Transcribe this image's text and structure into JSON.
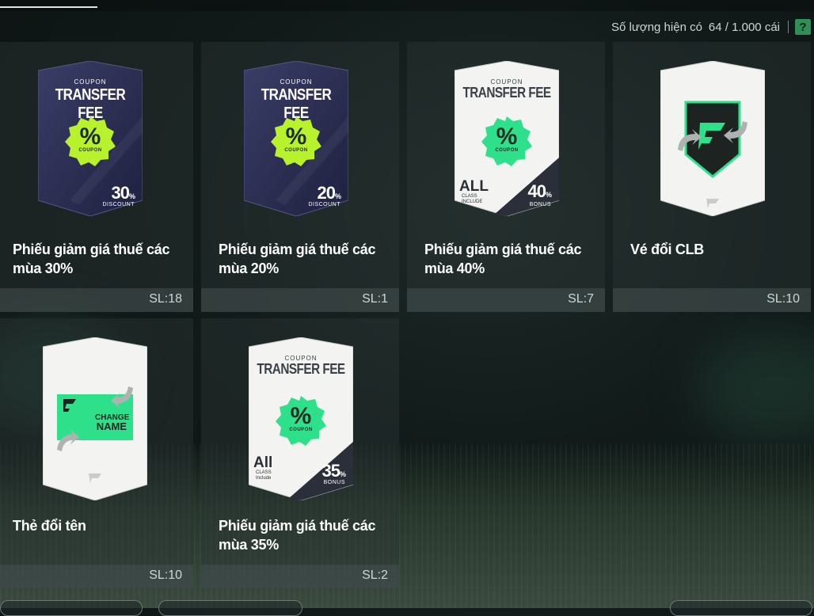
{
  "header": {
    "label": "Số lượng hiện có",
    "count": "64 / 1.000 cái",
    "help_label": "?"
  },
  "items": [
    {
      "name": "Phiếu giảm giá thuế các mùa 30%",
      "qty": "SL:18",
      "card": {
        "coupon": "COUPON",
        "title": "TRANSFER FEE",
        "badge_pct": "%",
        "badge_label": "COUPON",
        "value": "30",
        "value_unit": "%",
        "value_sub": "DISCOUNT"
      }
    },
    {
      "name": "Phiếu giảm giá thuế các mùa 20%",
      "qty": "SL:1",
      "card": {
        "coupon": "COUPON",
        "title": "TRANSFER FEE",
        "badge_pct": "%",
        "badge_label": "COUPON",
        "value": "20",
        "value_unit": "%",
        "value_sub": "DISCOUNT"
      }
    },
    {
      "name": "Phiếu giảm giá thuế các mùa 40%",
      "qty": "SL:7",
      "card": {
        "coupon": "COUPON",
        "title": "TRANSFER FEE",
        "badge_pct": "%",
        "badge_label": "COUPON",
        "value": "40",
        "value_unit": "%",
        "value_sub": "BONUS",
        "all": "ALL",
        "class_line1": "CLASS",
        "class_line2": "INCLUDE"
      }
    },
    {
      "name": "Vé đổi CLB",
      "qty": "SL:10"
    },
    {
      "name": "Thẻ đổi tên",
      "qty": "SL:10",
      "card": {
        "change1": "CHANGE",
        "change2": "NAME"
      }
    },
    {
      "name": "Phiếu giảm giá thuế các mùa 35%",
      "qty": "SL:2",
      "card": {
        "coupon": "COUPON",
        "title": "TRANSFER FEE",
        "badge_pct": "%",
        "badge_label": "COUPON",
        "value": "35",
        "value_unit": "%",
        "value_sub": "BONUS",
        "all": "All",
        "class_line1": "CLASS",
        "class_line2": "Include"
      }
    }
  ],
  "colors": {
    "accent_green": "#2ee08a",
    "dark_card": "#2c2f52",
    "help_green": "#2f8f57"
  }
}
